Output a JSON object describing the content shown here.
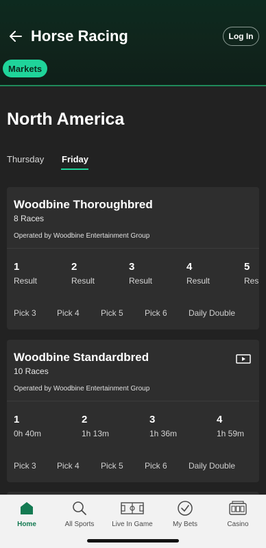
{
  "header": {
    "title": "Horse Racing",
    "login_label": "Log In",
    "markets_label": "Markets"
  },
  "region": {
    "title": "North America",
    "days": [
      "Thursday",
      "Friday"
    ],
    "active_day": "Friday"
  },
  "cards": [
    {
      "title": "Woodbine Thoroughbred",
      "races_count": "8 Races",
      "operator": "Operated by Woodbine Entertainment Group",
      "races": [
        {
          "number": "1",
          "status": "Result"
        },
        {
          "number": "2",
          "status": "Result"
        },
        {
          "number": "3",
          "status": "Result"
        },
        {
          "number": "4",
          "status": "Result"
        },
        {
          "number": "5",
          "status": "Result"
        }
      ],
      "bet_types": [
        "Pick 3",
        "Pick 4",
        "Pick 5",
        "Pick 6",
        "Daily Double"
      ]
    },
    {
      "title": "Woodbine Standardbred",
      "races_count": "10 Races",
      "operator": "Operated by Woodbine Entertainment Group",
      "has_video": true,
      "races": [
        {
          "number": "1",
          "status": "0h 40m"
        },
        {
          "number": "2",
          "status": "1h 13m"
        },
        {
          "number": "3",
          "status": "1h 36m"
        },
        {
          "number": "4",
          "status": "1h 59m"
        }
      ],
      "bet_types": [
        "Pick 3",
        "Pick 4",
        "Pick 5",
        "Pick 6",
        "Daily Double"
      ]
    }
  ],
  "tabbar": {
    "items": [
      {
        "label": "Home",
        "icon": "home-icon",
        "active": true
      },
      {
        "label": "All Sports",
        "icon": "search-icon"
      },
      {
        "label": "Live In Game",
        "icon": "pitch-icon"
      },
      {
        "label": "My Bets",
        "icon": "check-circle-icon"
      },
      {
        "label": "Casino",
        "icon": "slot-machine-icon"
      }
    ]
  },
  "colors": {
    "accent": "#1fd49a",
    "accent_dark": "#147a52",
    "background": "#222222",
    "card": "#2e2e2e"
  }
}
